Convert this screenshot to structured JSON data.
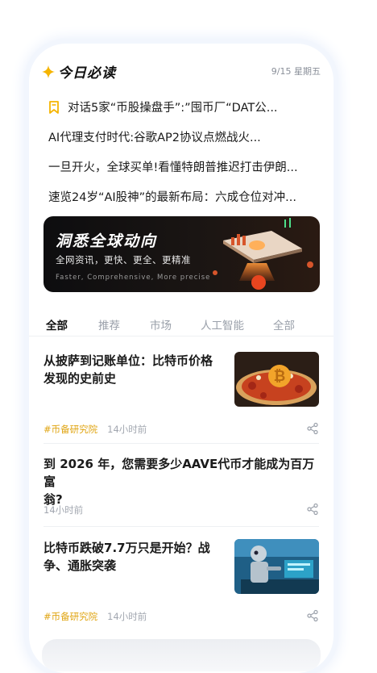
{
  "header": {
    "title": "今日必读",
    "date": "9/15 星期五"
  },
  "headlines": [
    "对话5家“币股操盘手”:”囤币厂“DAT公...",
    "AI代理支付时代:谷歌AP2协议点燃战火...",
    "一旦开火，全球买单!看懂特朗普推迟打击伊朗...",
    "速览24岁“AI股神”的最新布局：六成仓位对冲..."
  ],
  "banner": {
    "title": "洞悉全球动向",
    "subtitle": "全网资讯，更快、更全、更精准",
    "english": "Faster, Comprehensive, More precise"
  },
  "tabs": [
    "全部",
    "推荐",
    "市场",
    "人工智能",
    "全部"
  ],
  "articles": [
    {
      "title_line1": "从披萨到记账单位：比特币价格",
      "title_line2": "发现的史前史",
      "source": "#币备研究院",
      "time": "14小时前"
    },
    {
      "title_line1": "到 2026 年，您需要多少AAVE代币才能成为百万富",
      "title_line2": "翁?",
      "time": "14小时前"
    },
    {
      "title_line1": "比特币跌破7.7万只是开始？战",
      "title_line2": "争、通胀突袭",
      "source": "#币备研究院",
      "time": "14小时前"
    }
  ],
  "colors": {
    "accent": "#f5b400",
    "source": "#e0a513"
  }
}
